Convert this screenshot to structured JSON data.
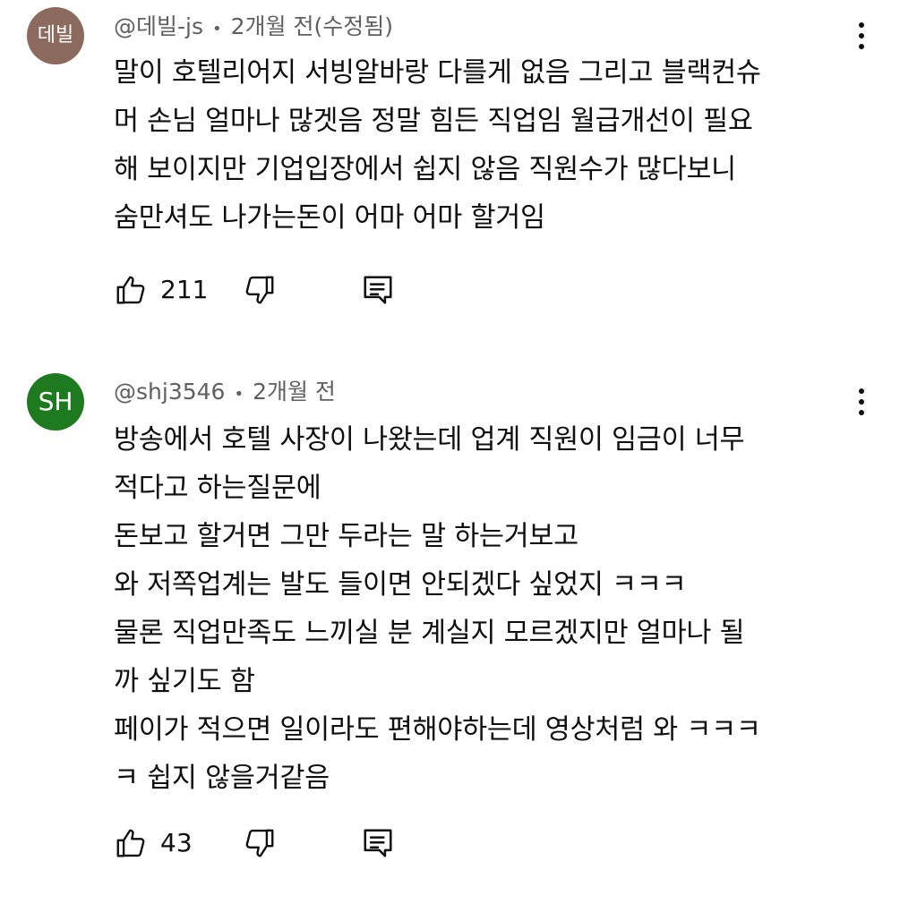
{
  "comments": [
    {
      "avatar_text": "데빌",
      "avatar_color": "#8d6a5e",
      "handle": "@데빌-js",
      "separator": "•",
      "time": "2개월 전(수정됨)",
      "lines": [
        "말이 호텔리어지 서빙알바랑 다를게 없음 그리고 블랙컨슈",
        "머 손님 얼마나 많겟음 정말 힘든 직업임 월급개선이 필요",
        "해 보이지만 기업입장에서 쉽지 않음 직원수가 많다보니",
        "숨만셔도 나가는돈이 어마 어마 할거임"
      ],
      "like_count": "211",
      "icons": {
        "like": "thumbs-up-icon",
        "dislike": "thumbs-down-icon",
        "reply": "reply-comment-icon",
        "menu": "more-vertical-icon"
      }
    },
    {
      "avatar_text": "SH",
      "avatar_color": "#1e7a1e",
      "handle": "@shj3546",
      "separator": "•",
      "time": "2개월 전",
      "lines": [
        "방송에서 호텔 사장이 나왔는데 업계 직원이 임금이 너무",
        "적다고 하는질문에",
        "돈보고 할거면 그만 두라는 말 하는거보고",
        "와 저쪽업계는 발도 들이면 안되겠다 싶었지 ㅋㅋㅋ",
        "물론 직업만족도 느끼실 분 계실지 모르겠지만 얼마나 될",
        "까 싶기도 함",
        "페이가 적으면 일이라도 편해야하는데 영상처럼 와 ㅋㅋㅋ",
        "ㅋ 쉽지 않을거같음"
      ],
      "like_count": "43",
      "icons": {
        "like": "thumbs-up-icon",
        "dislike": "thumbs-down-icon",
        "reply": "reply-comment-icon",
        "menu": "more-vertical-icon"
      }
    }
  ]
}
